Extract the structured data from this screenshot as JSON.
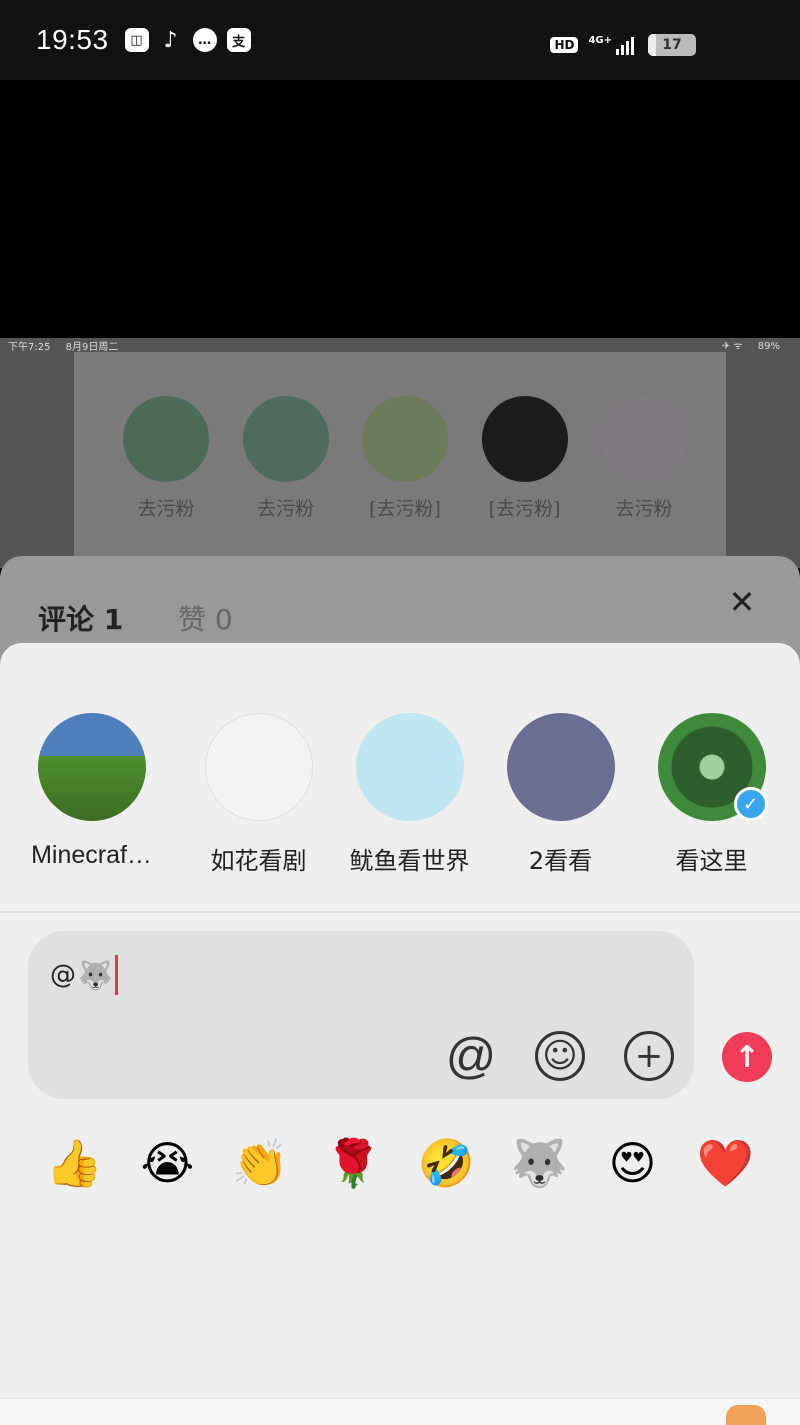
{
  "status_bar": {
    "time": "19:53",
    "app_icons": [
      "gallery-icon",
      "tiktok-icon",
      "message-icon",
      "alipay-icon"
    ],
    "hd_label": "HD",
    "network_label": "4G+",
    "battery_level": "17"
  },
  "embedded_screenshot": {
    "status_left": [
      "下午7:25",
      "8月9日周二"
    ],
    "status_right": "89%",
    "items": [
      {
        "label": "去污粉"
      },
      {
        "label": "去污粉"
      },
      {
        "label": "[去污粉]"
      },
      {
        "label": "[去污粉]"
      },
      {
        "label": "去污粉"
      }
    ]
  },
  "tabs": {
    "comments": "评论 1",
    "likes": "赞 0",
    "close_label": "✕"
  },
  "mention_contacts": [
    {
      "name": "Minecraf…",
      "verified": false
    },
    {
      "name": "如花看剧",
      "verified": false
    },
    {
      "name": "鱿鱼看世界",
      "verified": false
    },
    {
      "name": "2看看",
      "verified": false
    },
    {
      "name": "看这里",
      "verified": true
    }
  ],
  "comment_input": {
    "text": "@",
    "inline_emoji": "🐺"
  },
  "toolbar": {
    "at_label": "@",
    "emoji_label": "☺",
    "add_label": "+",
    "send_label": "↑"
  },
  "quick_emojis": [
    "👍",
    "😭",
    "👏",
    "🌹",
    "🤣",
    "🐺",
    "😍",
    "❤️"
  ],
  "colors": {
    "accent": "#f03c58",
    "verified": "#3aa6ef"
  }
}
